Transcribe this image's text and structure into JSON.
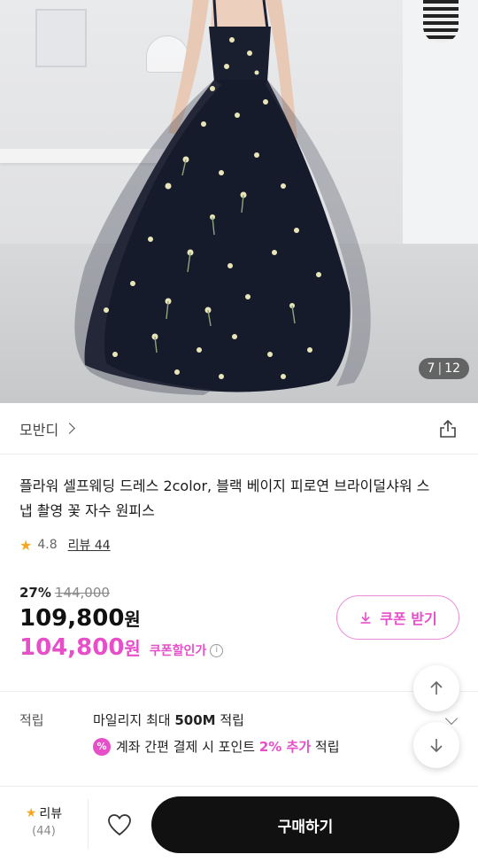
{
  "hero": {
    "image_alt": "플라워 셀프웨딩 드레스",
    "pager_current": "7",
    "pager_separator": "|",
    "pager_total": "12"
  },
  "brand": {
    "name": "모반디"
  },
  "product": {
    "title": "플라워 셀프웨딩 드레스 2color, 블랙 베이지 피로연 브라이덜샤워 스냅 촬영 꽃 자수 원피스",
    "rating": "4.8",
    "review_link": "리뷰 44"
  },
  "price": {
    "discount_rate": "27%",
    "original": "144,000",
    "sale": "109,800",
    "sale_unit": "원",
    "coupon_price": "104,800",
    "coupon_unit": "원",
    "coupon_label": "쿠폰할인가",
    "coupon_button": "쿠폰 받기"
  },
  "points": {
    "label": "적립",
    "line1_prefix": "마일리지 최대 ",
    "line1_bold": "500M",
    "line1_suffix": " 적립",
    "line2_prefix": "계좌 간편 결제 시 포인트 ",
    "line2_highlight": "2% 추가",
    "line2_suffix": " 적립",
    "badge": "%"
  },
  "bottom_bar": {
    "review_label": "리뷰",
    "review_count": "(44)",
    "buy_label": "구매하기"
  },
  "colors": {
    "accent_pink": "#e74fc9",
    "star": "#f5a623",
    "buy_button": "#111111"
  }
}
